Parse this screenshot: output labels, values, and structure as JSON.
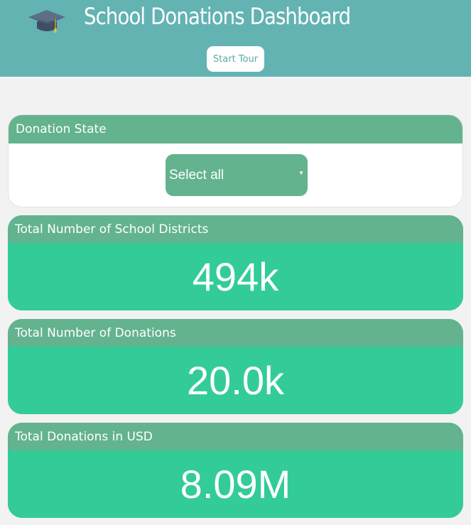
{
  "header": {
    "title": "School Donations Dashboard",
    "tour_button": "Start Tour",
    "logo_icon": "graduation-cap-icon",
    "background_color": "#63b3b3"
  },
  "filter": {
    "label": "Donation State",
    "selected": "Select all"
  },
  "metrics": [
    {
      "label": "Total Number of School Districts",
      "value": "494k"
    },
    {
      "label": "Total Number of Donations",
      "value": "20.0k"
    },
    {
      "label": "Total Donations in USD",
      "value": "8.09M"
    }
  ],
  "colors": {
    "card_header": "#63b38e",
    "metric_background": "#33cc99",
    "page_background": "#f2f2f2"
  }
}
